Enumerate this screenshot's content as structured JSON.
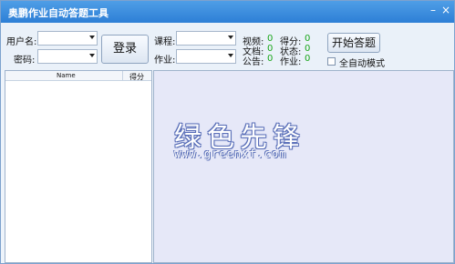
{
  "window": {
    "title": "奥鹏作业自动答题工具"
  },
  "titlebar": {
    "minimize": "–",
    "close": "×"
  },
  "login": {
    "username_label": "用户名:",
    "password_label": "密码:",
    "username_value": "",
    "password_value": "",
    "button_label": "登录"
  },
  "course": {
    "course_label": "课程:",
    "homework_label": "作业:",
    "course_value": "",
    "homework_value": ""
  },
  "stats": {
    "video_label": "视频:",
    "video_value": "0",
    "score_label": "得分:",
    "score_value": "0",
    "doc_label": "文档:",
    "doc_value": "0",
    "status_label": "状态:",
    "status_value": "0",
    "notice_label": "公告:",
    "notice_value": "0",
    "homework_label": "作业:",
    "homework_value": "0"
  },
  "actions": {
    "start_label": "开始答题",
    "auto_mode_label": "全自动模式",
    "auto_mode_checked": false
  },
  "list": {
    "columns": [
      "Name",
      "得分"
    ],
    "rows": []
  },
  "watermark": {
    "title": "绿色先锋",
    "url": "www.greenxf.com"
  },
  "colors": {
    "titlebar": "#2d7fd6",
    "stat_value": "#1aa61a",
    "content_bg": "#e6e8f8"
  }
}
